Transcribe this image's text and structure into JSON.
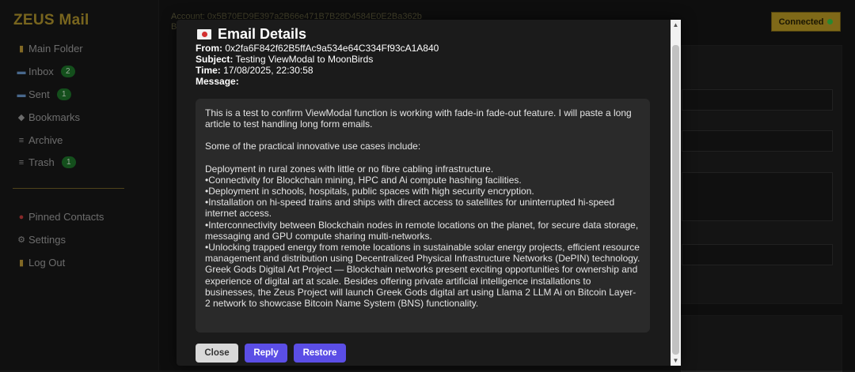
{
  "app": {
    "title": "ZEUS Mail"
  },
  "sidebar": {
    "items": [
      {
        "label": "Main Folder",
        "icon": "folder-icon"
      },
      {
        "label": "Inbox",
        "icon": "inbox-icon",
        "badge": "2"
      },
      {
        "label": "Sent",
        "icon": "sent-icon",
        "badge": "1"
      },
      {
        "label": "Bookmarks",
        "icon": "bookmark-icon"
      },
      {
        "label": "Archive",
        "icon": "archive-icon"
      },
      {
        "label": "Trash",
        "icon": "trash-icon",
        "badge": "1"
      }
    ],
    "secondary": [
      {
        "label": "Pinned Contacts",
        "icon": "pin-icon"
      },
      {
        "label": "Settings",
        "icon": "gear-icon"
      },
      {
        "label": "Log Out",
        "icon": "logout-icon"
      }
    ]
  },
  "header": {
    "account_line": "Account: 0x5B70ED9E397a2B66e471B7B28D4584E0E2Ba362b",
    "account_line2": "B",
    "connection_label": "Connected",
    "connection_color": "#3fd14b"
  },
  "modal": {
    "title": "Email Details",
    "from_label": "From:",
    "from_value": "0x2fa6F842f62B5ffAc9a534e64C334Ff93cA1A840",
    "subject_label": "Subject:",
    "subject_value": "Testing ViewModal to MoonBirds",
    "time_label": "Time:",
    "time_value": "17/08/2025, 22:30:58",
    "message_label": "Message:",
    "message": {
      "p1": "This is a test to confirm ViewModal function is working with fade-in fade-out feature. I will paste a long article to test handling long form emails.",
      "p2": "Some of the practical innovative use cases include:",
      "p3": "Deployment in rural zones with little or no fibre cabling infrastructure.",
      "bullets": [
        "•Connectivity for Blockchain mining, HPC and Ai compute hashing facilities.",
        "•Deployment in schools, hospitals, public spaces with high security encryption.",
        "•Installation on hi-speed trains and ships with direct access to satellites for uninterrupted hi-speed internet access.",
        "•Interconnectivity between Blockchain nodes in remote locations on the planet, for secure data storage, messaging and GPU compute sharing multi-networks.",
        "•Unlocking trapped energy from remote locations in sustainable solar energy projects, efficient resource management and distribution using Decentralized Physical Infrastructure Networks (DePIN) technology."
      ],
      "p4": "Greek Gods Digital Art Project — Blockchain networks present exciting opportunities for ownership and experience of digital art at scale. Besides offering private artificial intelligence installations to businesses, the Zeus Project will launch Greek Gods digital art using Llama 2 LLM Ai on Bitcoin Layer-2 network to showcase Bitcoin Name System (BNS) functionality."
    },
    "buttons": {
      "close": "Close",
      "reply": "Reply",
      "restore": "Restore"
    },
    "accent_color": "#5b4ee6"
  },
  "theme": {
    "brand_color": "#b99b2e",
    "badge_color": "#1f7a2c"
  }
}
